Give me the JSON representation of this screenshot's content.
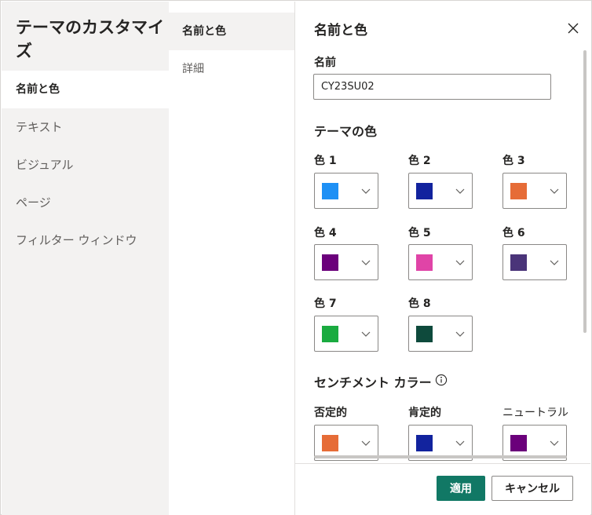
{
  "left_nav": {
    "title": "テーマのカスタマイズ",
    "items": [
      {
        "label": "名前と色",
        "active": true
      },
      {
        "label": "テキスト",
        "active": false
      },
      {
        "label": "ビジュアル",
        "active": false
      },
      {
        "label": "ページ",
        "active": false
      },
      {
        "label": "フィルター ウィンドウ",
        "active": false
      }
    ]
  },
  "sub_nav": {
    "items": [
      {
        "label": "名前と色",
        "active": true
      },
      {
        "label": "詳細",
        "active": false
      }
    ]
  },
  "panel": {
    "title": "名前と色",
    "close_icon": "close-icon",
    "name_label": "名前",
    "name_value": "CY23SU02",
    "theme_colors_heading": "テーマの色",
    "theme_colors": [
      {
        "label": "色 1",
        "color": "#1e90f5"
      },
      {
        "label": "色 2",
        "color": "#12239e"
      },
      {
        "label": "色 3",
        "color": "#e66c37"
      },
      {
        "label": "色 4",
        "color": "#6b007b"
      },
      {
        "label": "色 5",
        "color": "#e044a7"
      },
      {
        "label": "色 6",
        "color": "#4a3479"
      },
      {
        "label": "色 7",
        "color": "#1aab40"
      },
      {
        "label": "色 8",
        "color": "#0e4a3c"
      }
    ],
    "sentiment_heading": "センチメント カラー",
    "sentiment_info_icon": "info-icon",
    "sentiment_colors": [
      {
        "label": "否定的",
        "color": "#e66c37"
      },
      {
        "label": "肯定的",
        "color": "#12239e"
      },
      {
        "label": "ニュートラル",
        "color": "#6b007b"
      }
    ]
  },
  "footer": {
    "apply_label": "適用",
    "cancel_label": "キャンセル"
  },
  "colors": {
    "accent": "#117865",
    "nav_bg": "#f3f2f1"
  }
}
